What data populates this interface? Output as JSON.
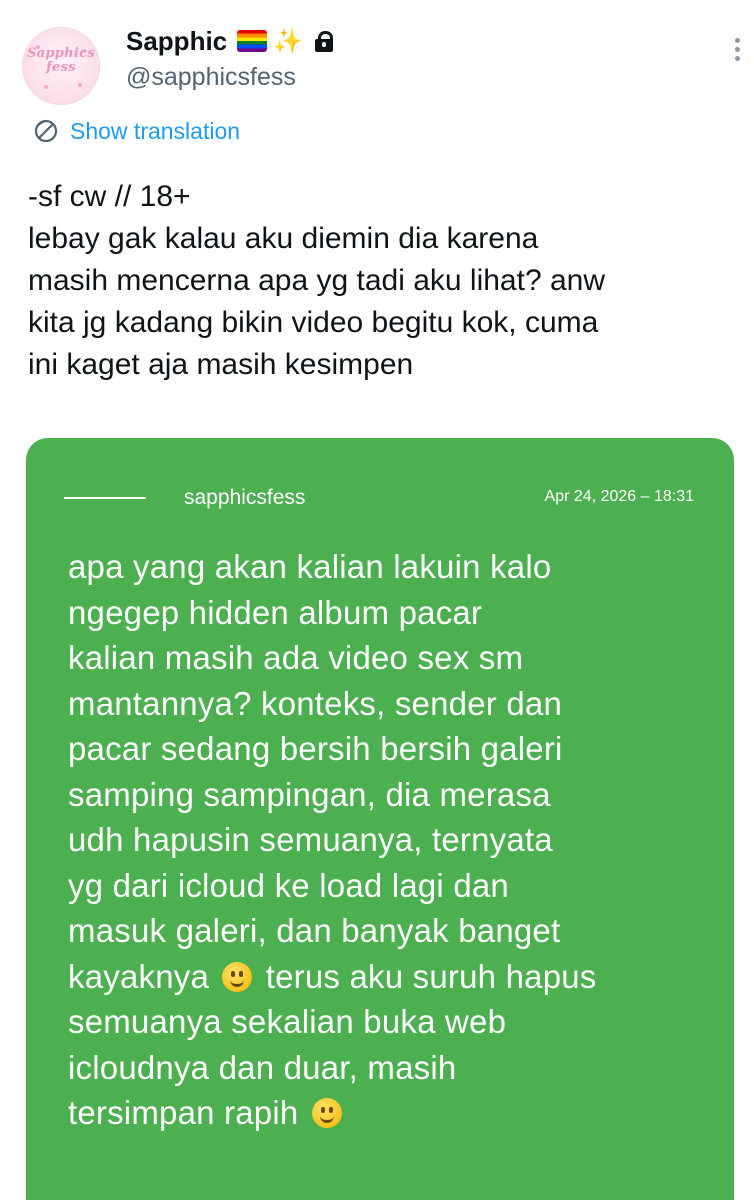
{
  "tweet": {
    "author_name": "Sapphic",
    "author_handle": "@sapphicsfess",
    "avatar_text_line1": "Sapphics",
    "avatar_text_line2": "fess",
    "show_translation": "Show translation",
    "text_lines": [
      "-sf cw // 18+",
      "lebay gak kalau aku diemin dia karena",
      "masih mencerna apa yg tadi aku lihat? anw",
      "kita jg kadang bikin video begitu kok, cuma",
      "ini kaget aja masih kesimpen"
    ]
  },
  "card": {
    "name": "sapphicsfess",
    "date": "Apr 24, 2026 – 18:31",
    "lines": [
      "apa yang akan kalian lakuin kalo",
      "ngegep hidden album pacar",
      "kalian masih ada video sex sm",
      "mantannya? konteks, sender dan",
      "pacar sedang bersih bersih galeri",
      "samping sampingan, dia merasa",
      "udh hapusin semuanya, ternyata",
      "yg dari icloud ke load lagi dan",
      "masuk galeri, dan banyak banget"
    ],
    "line10_before": "kayaknya",
    "line10_after": "terus aku suruh hapus",
    "lines_after": [
      "semuanya sekalian buka web",
      "icloudnya dan duar, masih"
    ],
    "last_line": "tersimpan rapih",
    "background_color": "#4caf50"
  },
  "colors": {
    "link": "#1d9bf0",
    "text": "#0f1419",
    "secondary": "#536471"
  }
}
